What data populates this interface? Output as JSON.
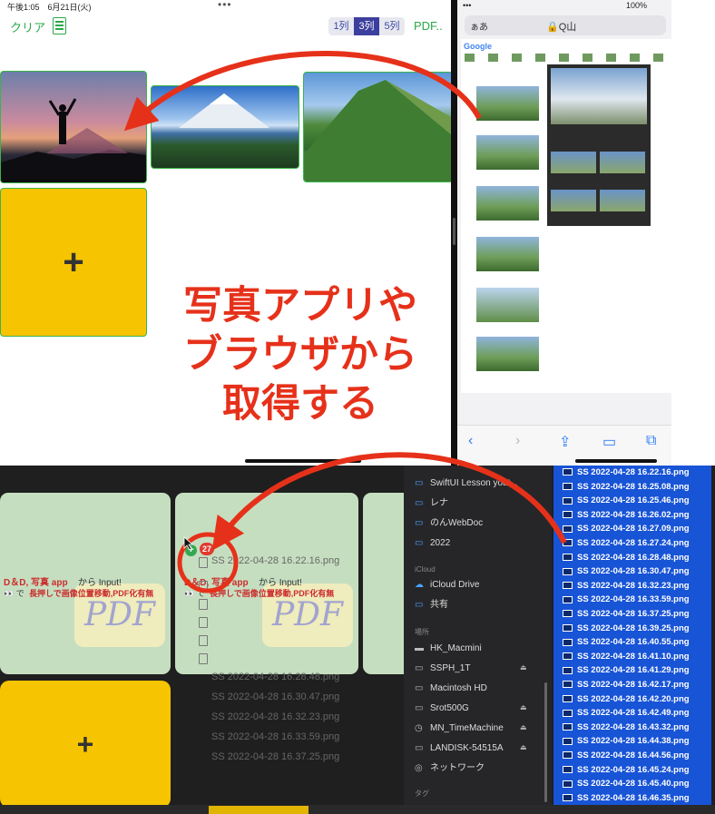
{
  "ipad": {
    "status_time": "午後1:05　6月21日(火)",
    "top_dots": "•••",
    "clear_label": "クリア",
    "column_segments": [
      "1列",
      "3列",
      "5列"
    ],
    "selected_segment": "3列",
    "pdf_label": "PDF..",
    "add_label": "+",
    "icons": {
      "doc": "document-icon"
    }
  },
  "safari": {
    "status_dots": "•••",
    "battery": "100%",
    "url_left": "ぁあ",
    "url_text": "🔒Q山",
    "google_logo": "Google",
    "toolbar_icons": [
      "back-icon",
      "forward-icon",
      "share-icon",
      "bookmarks-icon",
      "tabs-icon"
    ]
  },
  "annotation": {
    "caption_lines": [
      "写真アプリや",
      "ブラウザから",
      "取得する"
    ],
    "color": "#e6311a"
  },
  "mac": {
    "drag_caption_red": "D＆D, 写真 app",
    "drag_caption_black": "から Input!",
    "drag_caption_line2_prefix": "👀 で",
    "drag_caption_line2_red": "長押しで画像位置移動,PDF化有無",
    "pdf_ghost": "PDF",
    "add_label": "+",
    "drag_count": "27",
    "drag_plus": "+",
    "ghost_files": [
      "SS 2022-04-28 16.22.16.png",
      "SS 2022-04-28 16.28.48.png",
      "SS 2022-04-28 16.30.47.png",
      "SS 2022-04-28 16.32.23.png",
      "SS 2022-04-28 16.33.59.png",
      "SS 2022-04-28 16.37.25.png"
    ]
  },
  "finder": {
    "folders": [
      "SwiftUI Lesson yout...",
      "レナ",
      "のんWebDoc",
      "2022"
    ],
    "icloud_header": "iCloud",
    "icloud_items": [
      "iCloud Drive",
      "共有"
    ],
    "locations_header": "場所",
    "locations": [
      "HK_Macmini",
      "SSPH_1T",
      "Macintosh HD",
      "Srot500G",
      "MN_TimeMachine",
      "LANDISK-54515A",
      "ネットワーク"
    ],
    "tags_header": "タグ"
  },
  "files": [
    "SS 2022-04-28 16.22.16.png",
    "SS 2022-04-28 16.25.08.png",
    "SS 2022-04-28 16.25.46.png",
    "SS 2022-04-28 16.26.02.png",
    "SS 2022-04-28 16.27.09.png",
    "SS 2022-04-28 16.27.24.png",
    "SS 2022-04-28 16.28.48.png",
    "SS 2022-04-28 16.30.47.png",
    "SS 2022-04-28 16.32.23.png",
    "SS 2022-04-28 16.33.59.png",
    "SS 2022-04-28 16.37.25.png",
    "SS 2022-04-28 16.39.25.png",
    "SS 2022-04-28 16.40.55.png",
    "SS 2022-04-28 16.41.10.png",
    "SS 2022-04-28 16.41.29.png",
    "SS 2022-04-28 16.42.17.png",
    "SS 2022-04-28 16.42.20.png",
    "SS 2022-04-28 16.42.49.png",
    "SS 2022-04-28 16.43.32.png",
    "SS 2022-04-28 16.44.38.png",
    "SS 2022-04-28 16.44.56.png",
    "SS 2022-04-28 16.45.24.png",
    "SS 2022-04-28 16.45.40.png",
    "SS 2022-04-28 16.46.35.png"
  ]
}
